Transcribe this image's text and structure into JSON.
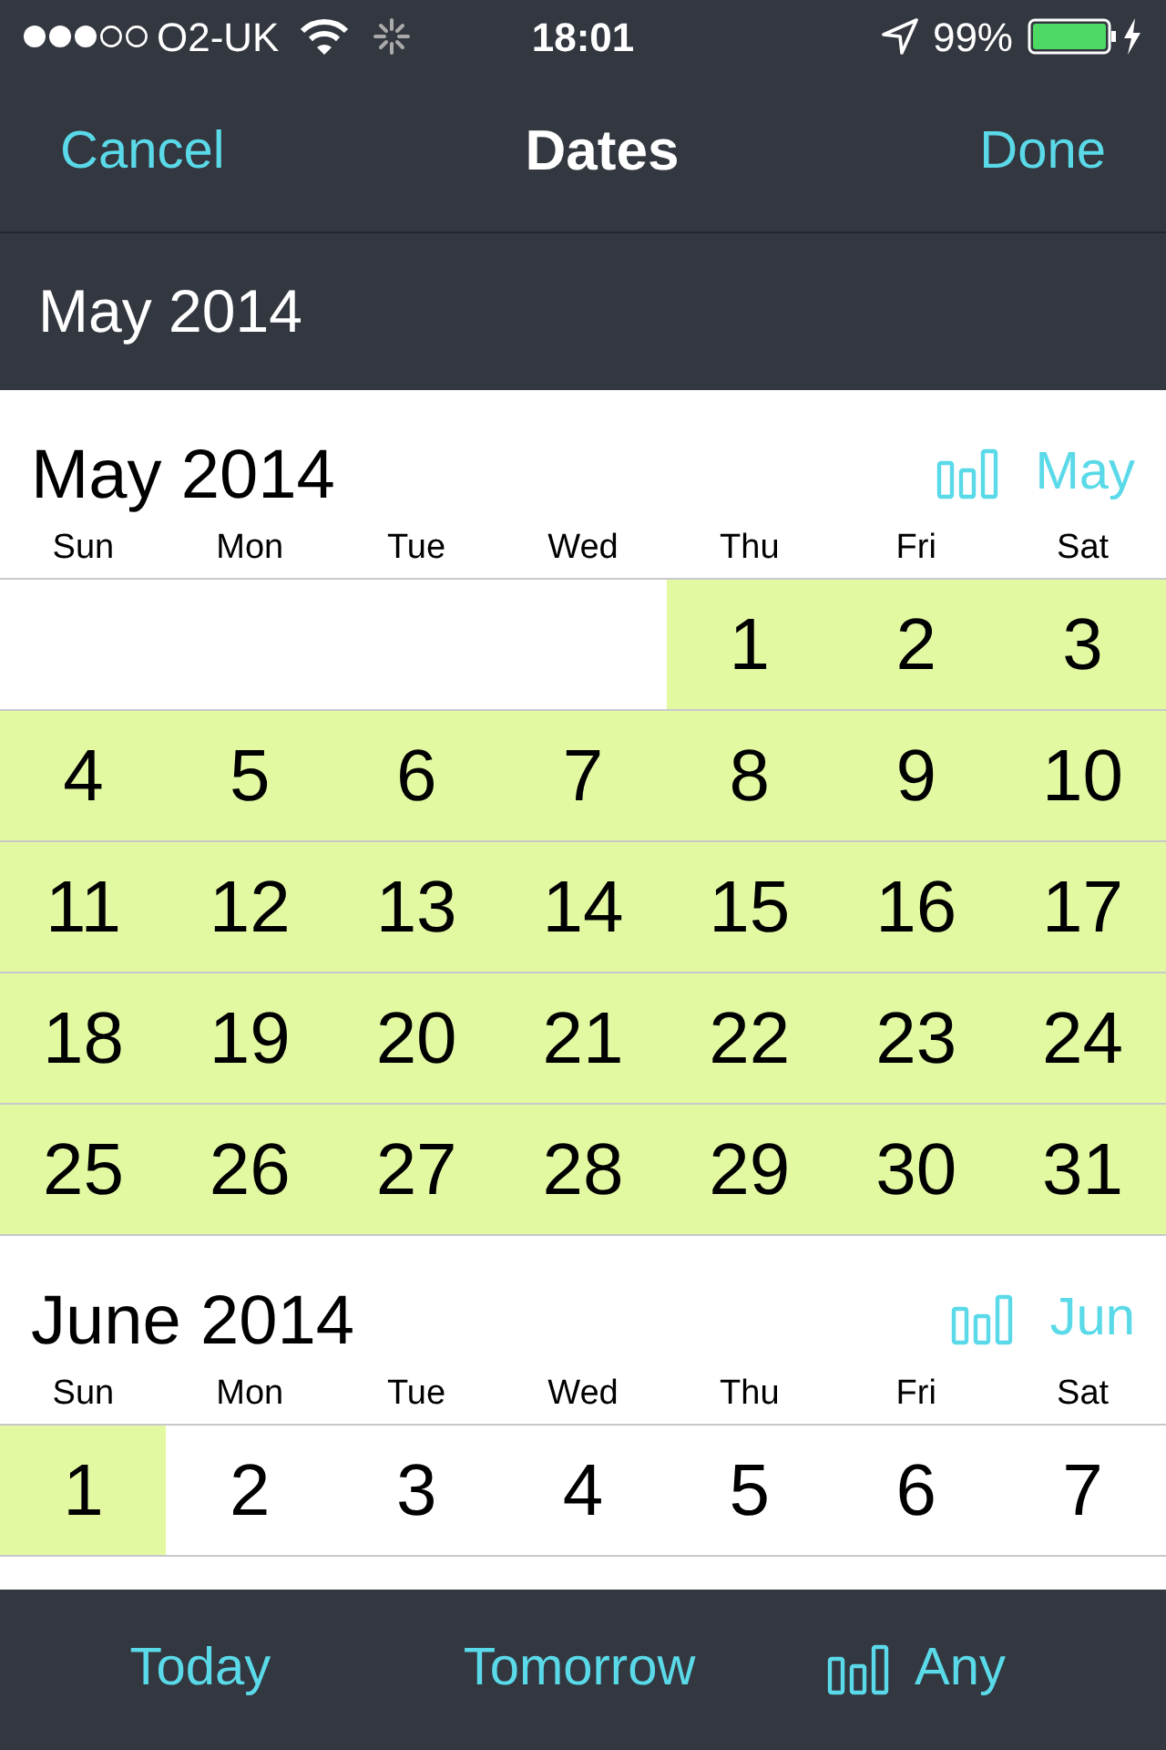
{
  "status_bar": {
    "carrier": "O2-UK",
    "time": "18:01",
    "battery": "99%"
  },
  "nav": {
    "cancel": "Cancel",
    "title": "Dates",
    "done": "Done"
  },
  "selection": "May 2014",
  "months": [
    {
      "title": "May 2014",
      "jump": "May",
      "weekdays": [
        "Sun",
        "Mon",
        "Tue",
        "Wed",
        "Thu",
        "Fri",
        "Sat"
      ],
      "weeks": [
        [
          {
            "kind": "blank"
          },
          {
            "kind": "blank"
          },
          {
            "kind": "blank"
          },
          {
            "kind": "blank"
          },
          {
            "kind": "day",
            "label": "1",
            "selected": true
          },
          {
            "kind": "day",
            "label": "2",
            "selected": true
          },
          {
            "kind": "day",
            "label": "3",
            "selected": true
          }
        ],
        [
          {
            "kind": "day",
            "label": "4",
            "selected": true
          },
          {
            "kind": "day",
            "label": "5",
            "selected": true
          },
          {
            "kind": "day",
            "label": "6",
            "selected": true
          },
          {
            "kind": "day",
            "label": "7",
            "selected": true
          },
          {
            "kind": "day",
            "label": "8",
            "selected": true
          },
          {
            "kind": "day",
            "label": "9",
            "selected": true
          },
          {
            "kind": "day",
            "label": "10",
            "selected": true
          }
        ],
        [
          {
            "kind": "day",
            "label": "11",
            "selected": true
          },
          {
            "kind": "day",
            "label": "12",
            "selected": true
          },
          {
            "kind": "day",
            "label": "13",
            "selected": true
          },
          {
            "kind": "day",
            "label": "14",
            "selected": true
          },
          {
            "kind": "day",
            "label": "15",
            "selected": true
          },
          {
            "kind": "day",
            "label": "16",
            "selected": true
          },
          {
            "kind": "day",
            "label": "17",
            "selected": true
          }
        ],
        [
          {
            "kind": "day",
            "label": "18",
            "selected": true
          },
          {
            "kind": "day",
            "label": "19",
            "selected": true
          },
          {
            "kind": "day",
            "label": "20",
            "selected": true
          },
          {
            "kind": "day",
            "label": "21",
            "selected": true
          },
          {
            "kind": "day",
            "label": "22",
            "selected": true
          },
          {
            "kind": "day",
            "label": "23",
            "selected": true
          },
          {
            "kind": "day",
            "label": "24",
            "selected": true
          }
        ],
        [
          {
            "kind": "day",
            "label": "25",
            "selected": true
          },
          {
            "kind": "day",
            "label": "26",
            "selected": true
          },
          {
            "kind": "day",
            "label": "27",
            "selected": true
          },
          {
            "kind": "day",
            "label": "28",
            "selected": true
          },
          {
            "kind": "day",
            "label": "29",
            "selected": true
          },
          {
            "kind": "day",
            "label": "30",
            "selected": true
          },
          {
            "kind": "day",
            "label": "31",
            "selected": true
          }
        ]
      ]
    },
    {
      "title": "June 2014",
      "jump": "Jun",
      "weekdays": [
        "Sun",
        "Mon",
        "Tue",
        "Wed",
        "Thu",
        "Fri",
        "Sat"
      ],
      "weeks": [
        [
          {
            "kind": "day",
            "label": "1",
            "selected": true
          },
          {
            "kind": "day",
            "label": "2",
            "selected": false
          },
          {
            "kind": "day",
            "label": "3",
            "selected": false
          },
          {
            "kind": "day",
            "label": "4",
            "selected": false
          },
          {
            "kind": "day",
            "label": "5",
            "selected": false
          },
          {
            "kind": "day",
            "label": "6",
            "selected": false
          },
          {
            "kind": "day",
            "label": "7",
            "selected": false
          }
        ]
      ]
    }
  ],
  "toolbar": {
    "today": "Today",
    "tomorrow": "Tomorrow",
    "any": "Any"
  }
}
